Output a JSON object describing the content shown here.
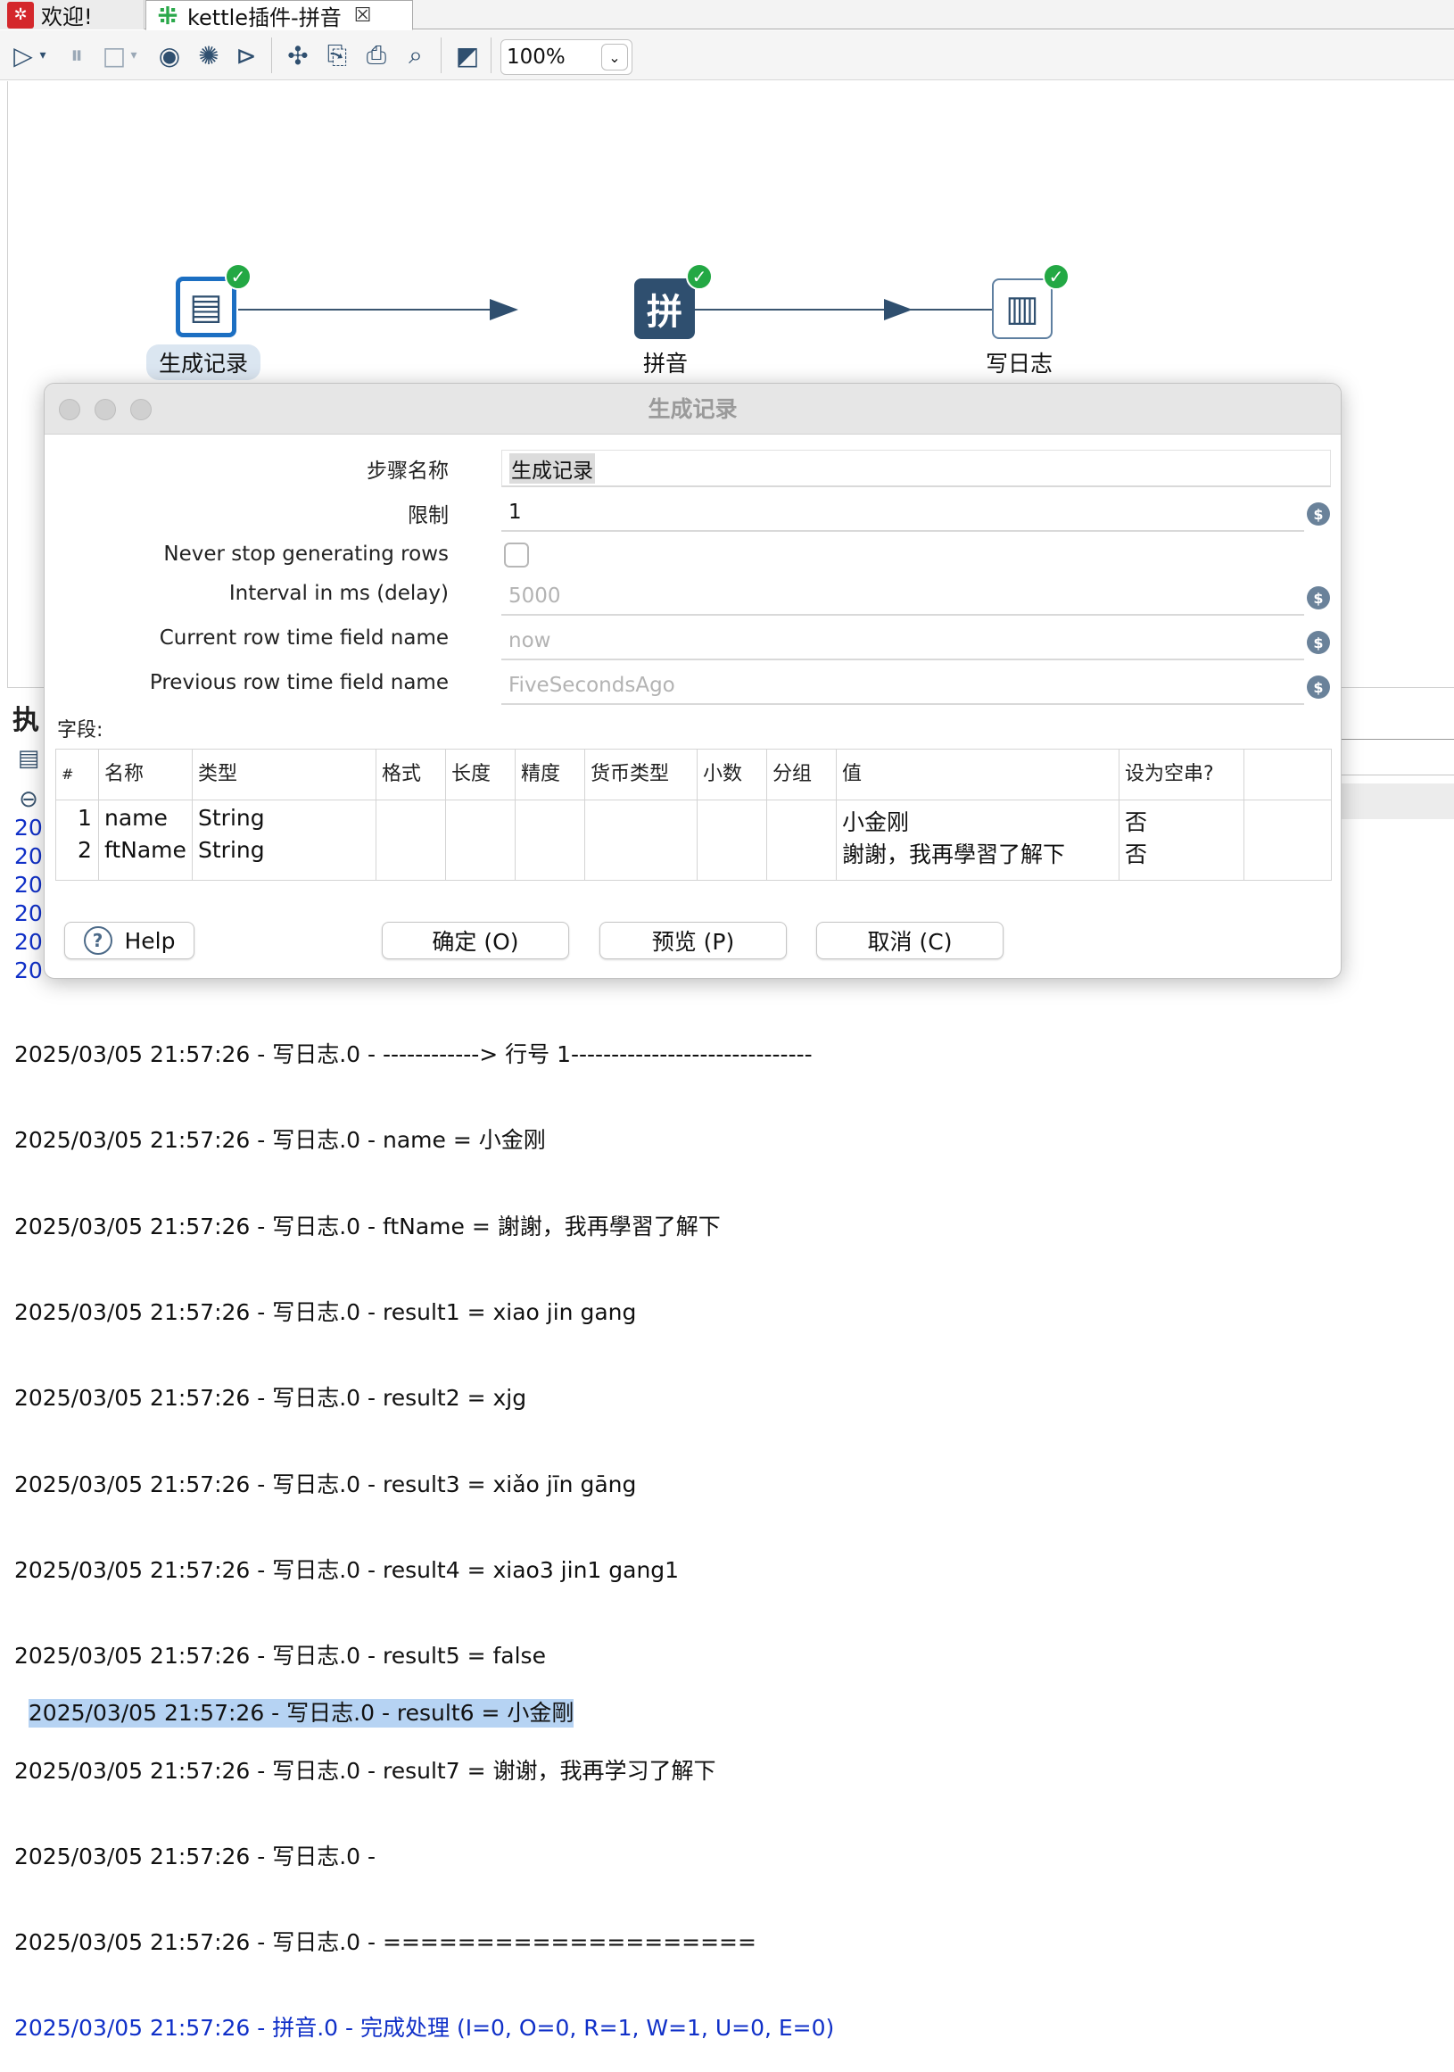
{
  "tabs": [
    {
      "label": "欢迎!",
      "icon": "kettle-welcome-icon"
    },
    {
      "label": "kettle插件-拼音",
      "icon": "transformation-icon",
      "close": "☒"
    }
  ],
  "toolbar": {
    "zoom": "100%"
  },
  "canvas": {
    "steps": [
      {
        "label": "生成记录",
        "glyph": "▤",
        "status": "✓"
      },
      {
        "label": "拼音",
        "glyph": "拼",
        "status": "✓"
      },
      {
        "label": "写日志",
        "glyph": "▥",
        "status": "✓"
      }
    ]
  },
  "panel": {
    "title": "执",
    "log_stub": [
      "20",
      "20",
      "20",
      "20",
      "20",
      "20"
    ],
    "log_lines": [
      "2025/03/05 21:57:26 - 写日志.0 - ------------> 行号 1------------------------------",
      "2025/03/05 21:57:26 - 写日志.0 - name = 小金刚",
      "2025/03/05 21:57:26 - 写日志.0 - ftName = 謝謝，我再學習了解下",
      "2025/03/05 21:57:26 - 写日志.0 - result1 = xiao jin gang",
      "2025/03/05 21:57:26 - 写日志.0 - result2 = xjg",
      "2025/03/05 21:57:26 - 写日志.0 - result3 = xiǎo jīn gāng",
      "2025/03/05 21:57:26 - 写日志.0 - result4 = xiao3 jin1 gang1",
      "2025/03/05 21:57:26 - 写日志.0 - result5 = false",
      "2025/03/05 21:57:26 - 写日志.0 - result6 = 小金剛",
      "2025/03/05 21:57:26 - 写日志.0 - result7 = 谢谢，我再学习了解下",
      "2025/03/05 21:57:26 - 写日志.0 - ",
      "2025/03/05 21:57:26 - 写日志.0 - ====================",
      "2025/03/05 21:57:26 - 拼音.0 - 完成处理 (I=0, O=0, R=1, W=1, U=0, E=0)"
    ]
  },
  "dialog": {
    "title": "生成记录",
    "step_name_label": "步骤名称",
    "step_name_value": "生成记录",
    "limit_label": "限制",
    "limit_value": "1",
    "never_stop_label": "Never stop generating rows",
    "interval_label": "Interval in ms (delay)",
    "interval_value": "5000",
    "current_row_label": "Current row time field name",
    "current_row_value": "now",
    "previous_row_label": "Previous row time field name",
    "previous_row_value": "FiveSecondsAgo",
    "fields_label": "字段:",
    "grid_headers": [
      "#",
      "名称",
      "类型",
      "格式",
      "长度",
      "精度",
      "货币类型",
      "小数",
      "分组",
      "值",
      "设为空串?"
    ],
    "grid_rows": [
      {
        "num": "1",
        "name": "name",
        "type": "String",
        "value": "小金刚",
        "empty": "否"
      },
      {
        "num": "2",
        "name": "ftName",
        "type": "String",
        "value": "謝謝，我再學習了解下",
        "empty": "否"
      }
    ],
    "buttons": {
      "help": "Help",
      "ok": "确定 (O)",
      "preview": "预览 (P)",
      "cancel": "取消 (C)"
    },
    "variable_icon": "$"
  }
}
